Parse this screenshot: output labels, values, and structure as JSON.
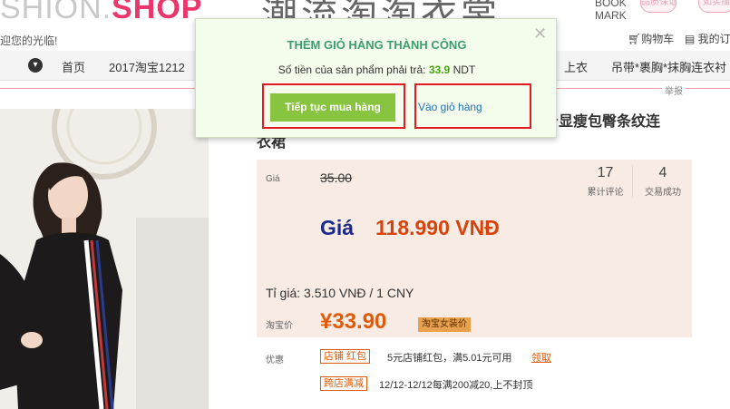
{
  "header": {
    "logo_faded": "SHION.",
    "logo_brand": "SHOP",
    "slogan": "迎您的光临!",
    "big_title": "潮流淘淘衣裳",
    "bookmark_line1": "BOOK",
    "bookmark_line2": "MARK",
    "icon_a": "品质保证",
    "icon_b": "如实描",
    "cart_link": "购物车",
    "mine_link": "我的订"
  },
  "nav": {
    "dropdown_icon": "chevron-down-icon",
    "items": [
      "首页",
      "2017淘宝1212",
      "上衣",
      "吊带*裹胸*抹胸连衣衬"
    ]
  },
  "report": "举报",
  "product": {
    "title_line1": "身显瘦包臀条纹连",
    "title_line2": "衣裙",
    "price_label": "Giá",
    "old_price": "35.00",
    "stats": [
      {
        "value": "17",
        "label": "累计评论"
      },
      {
        "value": "4",
        "label": "交易成功"
      }
    ],
    "vnd_label": "Giá",
    "vnd_value": "118.990 VNĐ",
    "rate": "Tỉ giá: 3.510 VNĐ / 1 CNY",
    "taobao_label": "淘宝价",
    "taobao_price": "¥33.90",
    "taobao_badge": "淘宝女装价"
  },
  "promos": [
    {
      "label": "优惠",
      "tag": "店铺 红包",
      "text": "5元店铺红包，满5.01元可用",
      "link": "领取"
    },
    {
      "label": "",
      "tag": "跨店满减",
      "text": "12/12-12/12每满200减20,上不封顶",
      "link": ""
    }
  ],
  "modal": {
    "title": "THÊM GIỎ HÀNG THÀNH CÔNG",
    "message_prefix": "Số tiền của sản phẩm phải trả:",
    "amount": "33.9",
    "currency": "NDT",
    "continue_label": "Tiếp tục mua hàng",
    "cart_label": "Vào giỏ hàng",
    "close_icon": "close-icon"
  },
  "colors": {
    "modal_bg": "#f4fceb",
    "modal_title": "#3d9e6c",
    "continue_btn": "#89c441",
    "highlight": "#e01b24",
    "vnd_label": "#1a2a8c",
    "price": "#d8430c"
  }
}
